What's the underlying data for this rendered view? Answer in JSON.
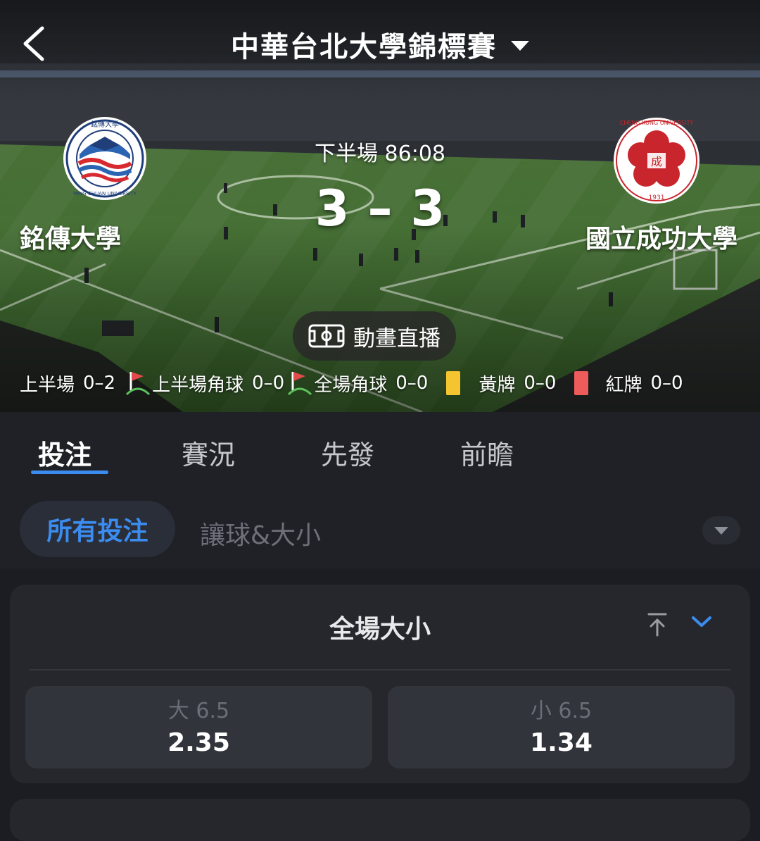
{
  "header": {
    "title": "中華台北大學錦標賽"
  },
  "match": {
    "period_time": "下半場 86:08",
    "home": {
      "name": "銘傳大學",
      "score": "3",
      "logo_text": "MING CHUAN UNIVERSITY",
      "logo_cjk": "銘傳大學"
    },
    "away": {
      "name": "國立成功大學",
      "score": "3",
      "logo_text": "CHENG KUNG UNIVERSITY",
      "logo_year": "1931"
    },
    "score_separator": "–"
  },
  "animation_button": {
    "label": "動畫直播",
    "icon": "pitch-icon"
  },
  "stats": [
    {
      "label": "上半場",
      "value": "0–2"
    },
    {
      "label": "上半場角球",
      "value": "0–0",
      "icon": "corner-flag-icon"
    },
    {
      "label": "全場角球",
      "value": "0–0",
      "icon": "corner-flag-icon"
    },
    {
      "label": "黃牌",
      "value": "0–0",
      "icon": "yellow-card-icon",
      "color": "#f5c531"
    },
    {
      "label": "紅牌",
      "value": "0–0",
      "icon": "red-card-icon",
      "color": "#ee5b5b"
    }
  ],
  "tabs": [
    {
      "label": "投注",
      "active": true
    },
    {
      "label": "賽況"
    },
    {
      "label": "先發"
    },
    {
      "label": "前瞻"
    }
  ],
  "filters": {
    "active": "所有投注",
    "other": "讓球&大小"
  },
  "market": {
    "title": "全場大小",
    "options": [
      {
        "line": "大 6.5",
        "price": "2.35"
      },
      {
        "line": "小 6.5",
        "price": "1.34"
      }
    ]
  },
  "colors": {
    "accent": "#3c8cf0",
    "background": "#1b1d22",
    "card": "#25272d",
    "odd_button": "#32343b"
  }
}
